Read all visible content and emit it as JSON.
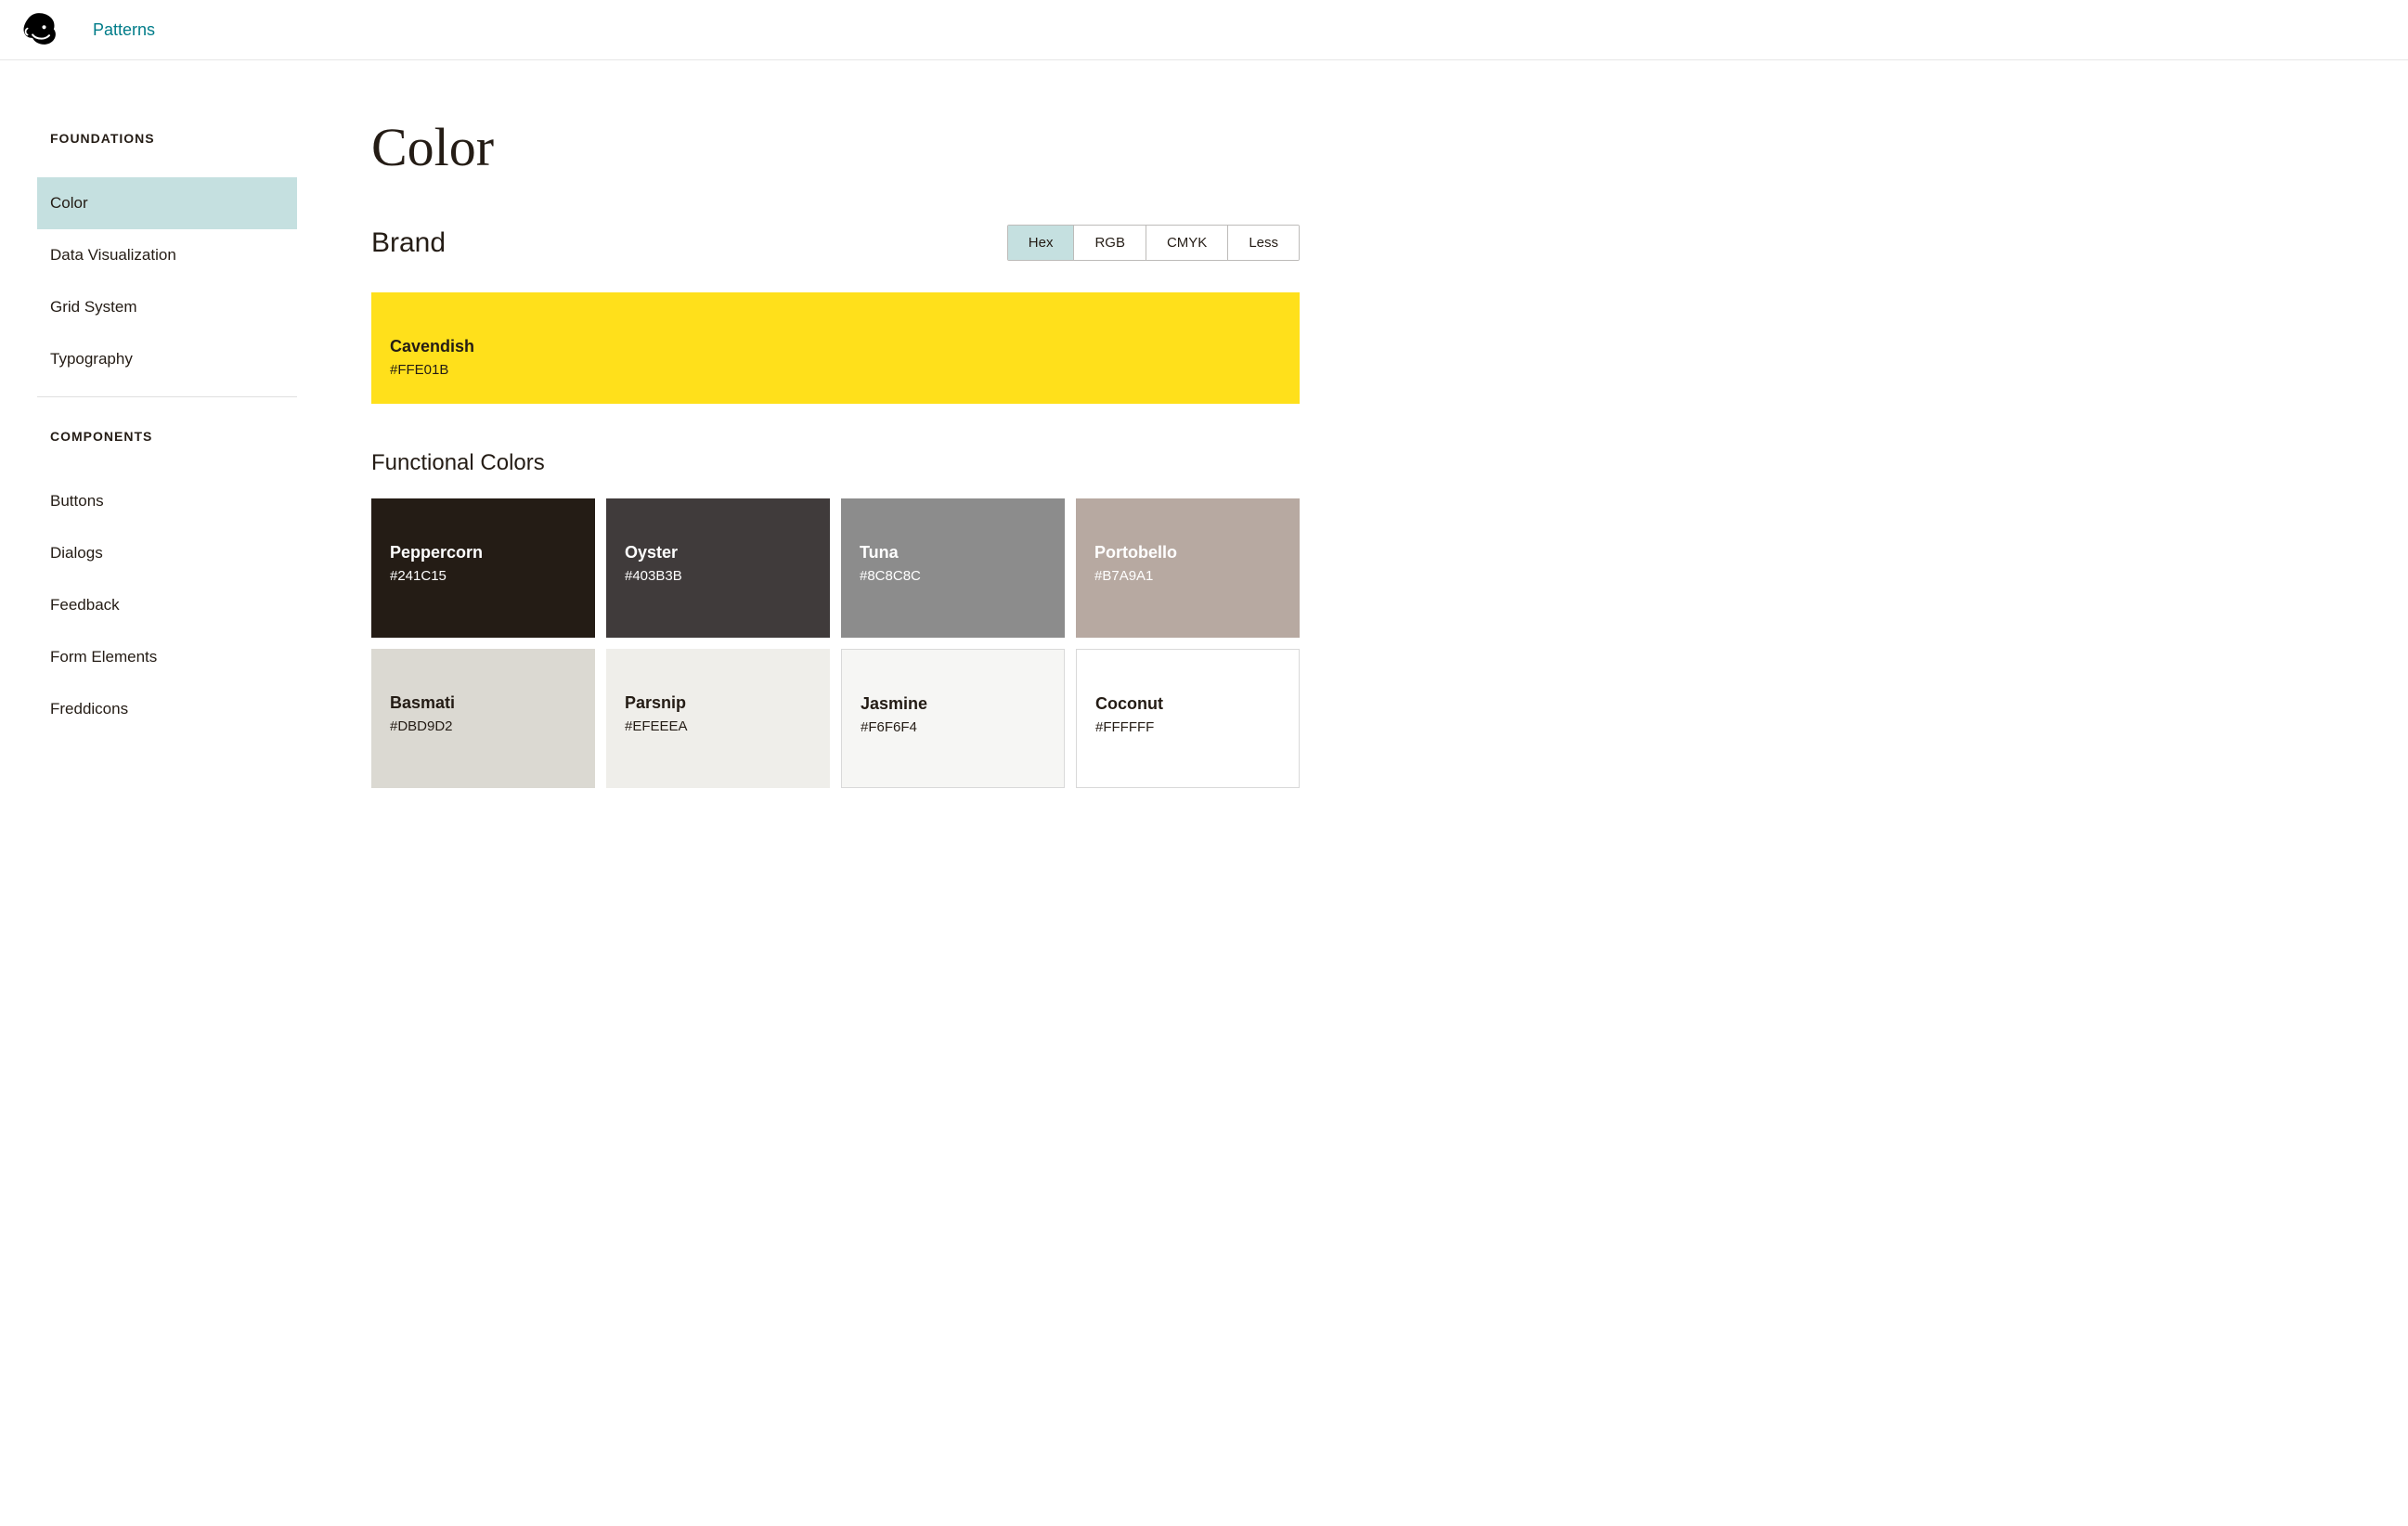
{
  "header": {
    "patterns_link": "Patterns"
  },
  "sidebar": {
    "sections": [
      {
        "title": "FOUNDATIONS",
        "items": [
          {
            "label": "Color",
            "active": true
          },
          {
            "label": "Data Visualization",
            "active": false
          },
          {
            "label": "Grid System",
            "active": false
          },
          {
            "label": "Typography",
            "active": false
          }
        ]
      },
      {
        "title": "COMPONENTS",
        "items": [
          {
            "label": "Buttons",
            "active": false
          },
          {
            "label": "Dialogs",
            "active": false
          },
          {
            "label": "Feedback",
            "active": false
          },
          {
            "label": "Form Elements",
            "active": false
          },
          {
            "label": "Freddicons",
            "active": false
          }
        ]
      }
    ]
  },
  "page": {
    "title": "Color",
    "brand_section_title": "Brand",
    "format_toggles": [
      "Hex",
      "RGB",
      "CMYK",
      "Less"
    ],
    "active_toggle": "Hex",
    "brand_swatch": {
      "name": "Cavendish",
      "value": "#FFE01B",
      "bg": "#FFE01B",
      "text": "dark"
    },
    "functional_section_title": "Functional Colors",
    "functional_swatches": [
      {
        "name": "Peppercorn",
        "value": "#241C15",
        "bg": "#241C15",
        "text": "light",
        "bordered": false
      },
      {
        "name": "Oyster",
        "value": "#403B3B",
        "bg": "#403B3B",
        "text": "light",
        "bordered": false
      },
      {
        "name": "Tuna",
        "value": "#8C8C8C",
        "bg": "#8C8C8C",
        "text": "light",
        "bordered": false
      },
      {
        "name": "Portobello",
        "value": "#B7A9A1",
        "bg": "#B7A9A1",
        "text": "light",
        "bordered": false
      },
      {
        "name": "Basmati",
        "value": "#DBD9D2",
        "bg": "#DBD9D2",
        "text": "dark",
        "bordered": false
      },
      {
        "name": "Parsnip",
        "value": "#EFEEEA",
        "bg": "#EFEEEA",
        "text": "dark",
        "bordered": false
      },
      {
        "name": "Jasmine",
        "value": "#F6F6F4",
        "bg": "#F6F6F4",
        "text": "dark",
        "bordered": true
      },
      {
        "name": "Coconut",
        "value": "#FFFFFF",
        "bg": "#FFFFFF",
        "text": "dark",
        "bordered": true
      }
    ]
  }
}
